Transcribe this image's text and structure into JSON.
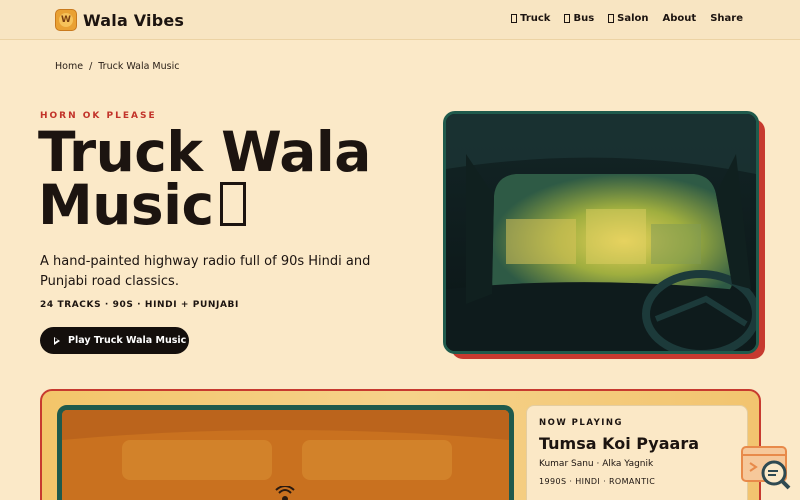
{
  "nav": {
    "brand_logo_letter": "W",
    "brand": "Wala Vibes",
    "links": [
      {
        "label": "Truck",
        "icon": "truck-icon"
      },
      {
        "label": "Bus",
        "icon": "bus-icon"
      },
      {
        "label": "Salon",
        "icon": "salon-icon"
      },
      {
        "label": "About"
      },
      {
        "label": "Share"
      }
    ]
  },
  "breadcrumb": {
    "home": "Home",
    "separator": "/",
    "current": "Truck Wala Music"
  },
  "hero": {
    "eyebrow": "HORN OK PLEASE",
    "title_line1": "Truck Wala",
    "title_line2": "Music",
    "description": "A hand-painted highway radio full of 90s Hindi and Punjabi road classics.",
    "meta": "24 TRACKS · 90S · HINDI + PUNJABI",
    "play_button": "Play Truck Wala Music"
  },
  "now_playing": {
    "label": "NOW PLAYING",
    "title": "Tumsa Koi Pyaara",
    "artists": "Kumar Sanu · Alka Yagnik",
    "tags": "1990S · HINDI · ROMANTIC"
  },
  "colors": {
    "background": "#fbe9c8",
    "accent_red": "#c2332a",
    "frame_green": "#1f5a4c",
    "button_dark": "#140f0c"
  }
}
